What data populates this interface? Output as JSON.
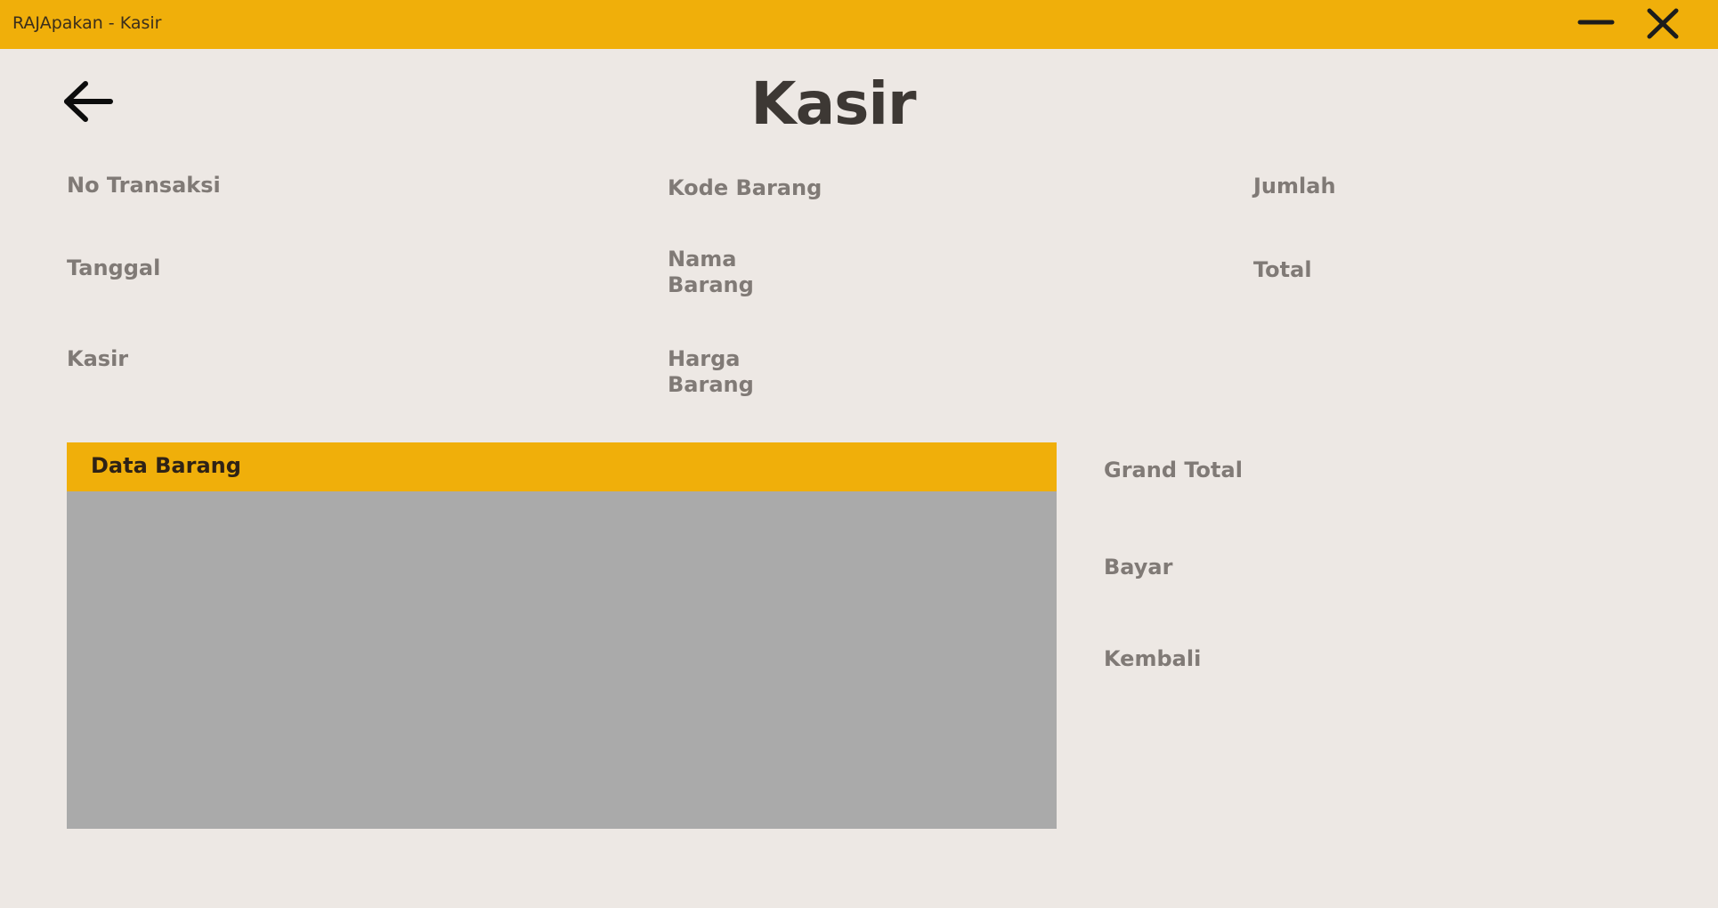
{
  "window": {
    "title": "RAJApakan - Kasir",
    "minimize_icon": "minimize-icon",
    "close_icon": "close-icon"
  },
  "header": {
    "back_icon": "arrow-left-icon",
    "title": "Kasir"
  },
  "form": {
    "transaction": {
      "no_transaksi": "No Transaksi",
      "tanggal": "Tanggal",
      "kasir": "Kasir"
    },
    "item": {
      "kode_barang": "Kode Barang",
      "nama_barang": "Nama Barang",
      "harga_barang": "Harga Barang"
    },
    "quantity": {
      "jumlah": "Jumlah",
      "total": "Total"
    }
  },
  "table": {
    "title": "Data Barang"
  },
  "payment": {
    "grand_total": "Grand Total",
    "bayar": "Bayar",
    "kembali": "Kembali"
  },
  "colors": {
    "accent": "#f0af0a",
    "background": "#ede8e4",
    "label": "#807a76",
    "title": "#3d3834",
    "table_body": "#aaaaaa"
  }
}
